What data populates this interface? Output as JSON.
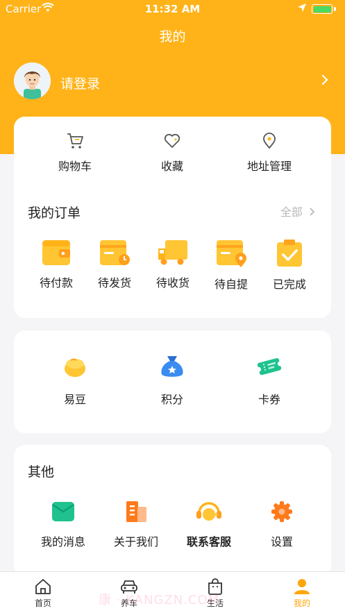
{
  "status_bar": {
    "carrier": "Carrier",
    "time": "11:32 AM"
  },
  "nav": {
    "title": "我的"
  },
  "profile": {
    "login_text": "请登录"
  },
  "quick_actions": [
    {
      "label": "购物车",
      "icon": "cart-icon"
    },
    {
      "label": "收藏",
      "icon": "heart-icon"
    },
    {
      "label": "地址管理",
      "icon": "location-pin-icon"
    }
  ],
  "orders": {
    "title": "我的订单",
    "see_all": "全部",
    "items": [
      {
        "label": "待付款",
        "icon": "wallet-icon"
      },
      {
        "label": "待发货",
        "icon": "box-clock-icon"
      },
      {
        "label": "待收货",
        "icon": "truck-icon"
      },
      {
        "label": "待自提",
        "icon": "box-pin-icon"
      },
      {
        "label": "已完成",
        "icon": "clipboard-check-icon"
      }
    ]
  },
  "assets": [
    {
      "label": "易豆",
      "icon": "bean-icon"
    },
    {
      "label": "积分",
      "icon": "money-bag-icon"
    },
    {
      "label": "卡券",
      "icon": "coupon-icon"
    }
  ],
  "others": {
    "title": "其他",
    "items": [
      {
        "label": "我的消息",
        "icon": "message-envelope-icon"
      },
      {
        "label": "关于我们",
        "icon": "building-icon"
      },
      {
        "label": "联系客服",
        "icon": "headset-icon"
      },
      {
        "label": "设置",
        "icon": "gear-icon"
      }
    ]
  },
  "tabbar": [
    {
      "label": "首页",
      "icon": "home-icon"
    },
    {
      "label": "养车",
      "icon": "car-icon"
    },
    {
      "label": "生活",
      "icon": "bag-icon"
    },
    {
      "label": "我的",
      "icon": "person-icon"
    }
  ],
  "colors": {
    "primary": "#ffb319",
    "active_tab": "#ffa60d",
    "background": "#f5f5f7"
  },
  "watermark": "康 · KANGZN.COM"
}
